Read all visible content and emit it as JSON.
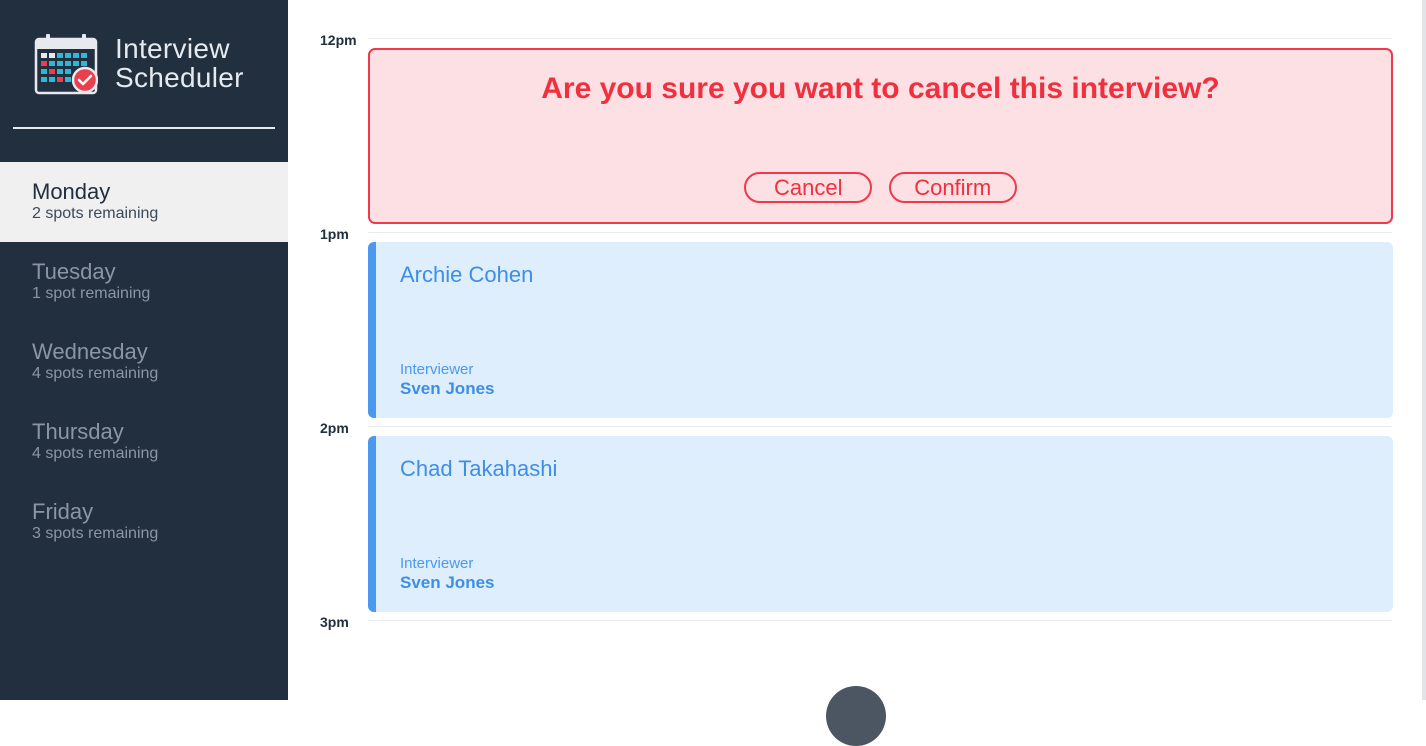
{
  "app": {
    "title_line1": "Interview",
    "title_line2": "Scheduler"
  },
  "days": [
    {
      "name": "Monday",
      "spots": "2 spots remaining",
      "selected": true
    },
    {
      "name": "Tuesday",
      "spots": "1 spot remaining",
      "selected": false
    },
    {
      "name": "Wednesday",
      "spots": "4 spots remaining",
      "selected": false
    },
    {
      "name": "Thursday",
      "spots": "4 spots remaining",
      "selected": false
    },
    {
      "name": "Friday",
      "spots": "3 spots remaining",
      "selected": false
    }
  ],
  "times": [
    "12pm",
    "1pm",
    "2pm",
    "3pm"
  ],
  "confirm": {
    "message": "Are you sure you want to cancel this interview?",
    "cancel_label": "Cancel",
    "confirm_label": "Confirm"
  },
  "appointments": [
    {
      "student": "Archie Cohen",
      "interviewer_label": "Interviewer",
      "interviewer": "Sven Jones"
    },
    {
      "student": "Chad Takahashi",
      "interviewer_label": "Interviewer",
      "interviewer": "Sven Jones"
    }
  ],
  "colors": {
    "sidebar": "#222f3e",
    "danger": "#f0303f",
    "danger_bg": "#fde0e3",
    "accent": "#4a99ef",
    "appointment_bg": "#dfeefc"
  },
  "icons": {
    "logo": "calendar-check-icon"
  }
}
